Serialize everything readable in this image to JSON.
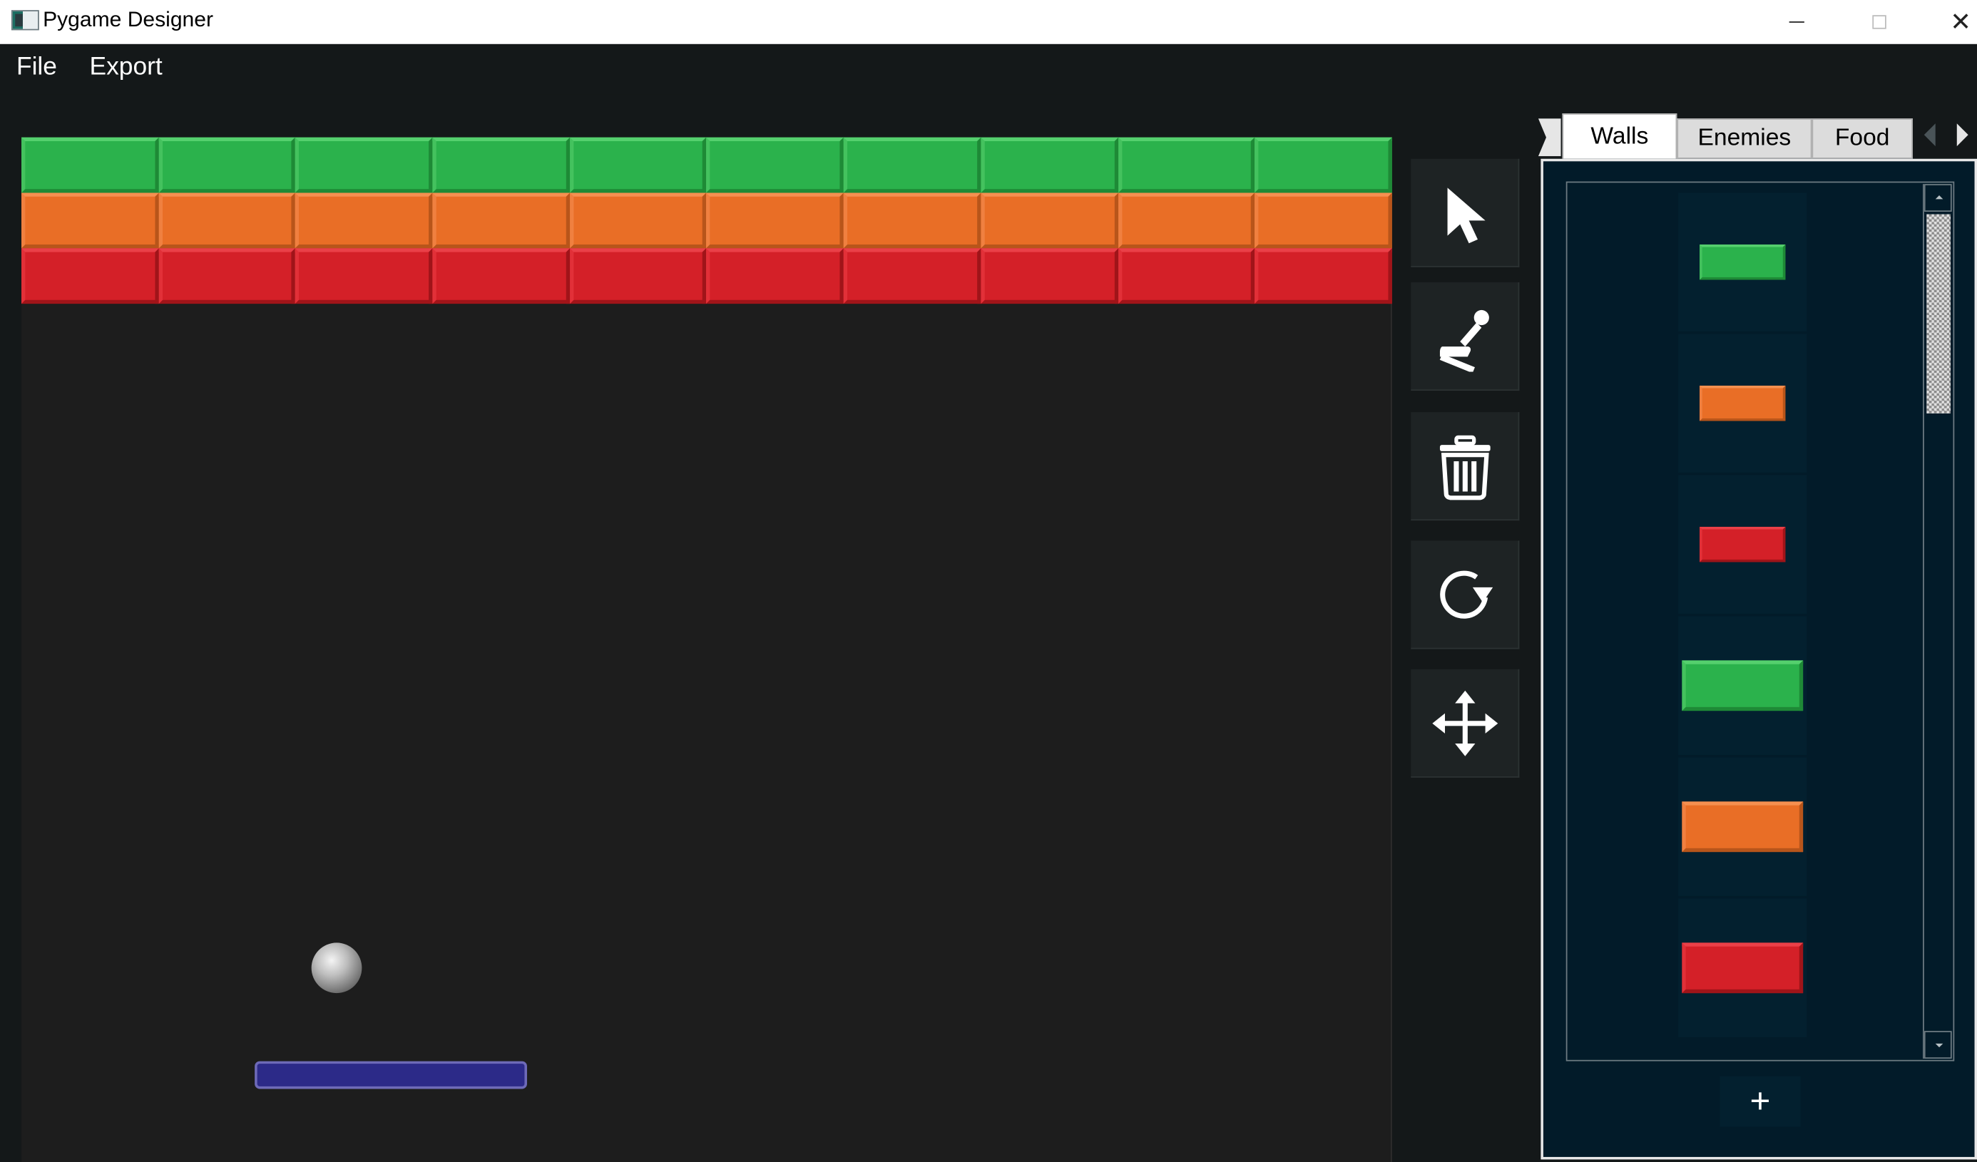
{
  "window": {
    "title": "Pygame Designer",
    "minimize_icon": "minimize-icon",
    "maximize_icon": "maximize-icon",
    "close_glyph": "✕"
  },
  "menu": {
    "file": "File",
    "export": "Export"
  },
  "canvas": {
    "brick_rows": [
      {
        "color": "green",
        "count": 10
      },
      {
        "color": "orange",
        "count": 10
      },
      {
        "color": "red",
        "count": 10
      }
    ],
    "ball_icon": "ball",
    "paddle_color": "#2c2a88"
  },
  "tools": [
    {
      "name": "select-tool-button",
      "icon": "cursor-arrow-icon"
    },
    {
      "name": "stamp-tool-button",
      "icon": "stamp-icon"
    },
    {
      "name": "delete-tool-button",
      "icon": "trash-icon"
    },
    {
      "name": "rotate-tool-button",
      "icon": "rotate-icon"
    },
    {
      "name": "move-tool-button",
      "icon": "move-arrows-icon"
    }
  ],
  "panel": {
    "tabs": [
      "Walls",
      "Enemies",
      "Food"
    ],
    "active_tab": "Walls",
    "items": [
      {
        "color": "green",
        "size": "small"
      },
      {
        "color": "orange",
        "size": "small"
      },
      {
        "color": "red",
        "size": "small"
      },
      {
        "color": "green",
        "size": "large"
      },
      {
        "color": "orange",
        "size": "large"
      },
      {
        "color": "red",
        "size": "large"
      }
    ],
    "add_label": "+"
  },
  "colors": {
    "green": "#2bb24c",
    "orange": "#e96e26",
    "red": "#d42028",
    "panel_bg": "#021b29",
    "canvas_bg": "#1d1d1d"
  }
}
